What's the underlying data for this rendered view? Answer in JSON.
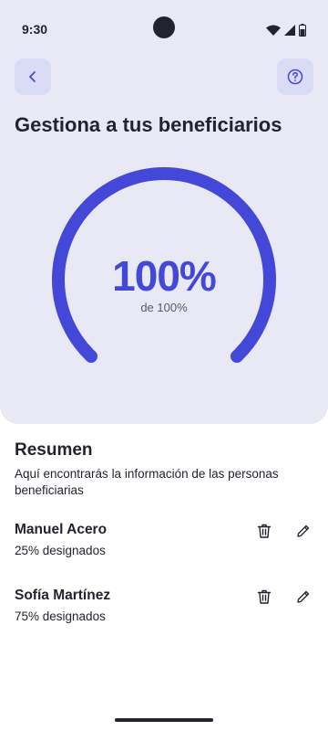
{
  "status_bar": {
    "time": "9:30"
  },
  "header": {
    "title": "Gestiona a tus beneficiarios",
    "back_icon": "chevron-left-icon",
    "help_icon": "help-circle-icon"
  },
  "gauge": {
    "value_label": "100%",
    "subtitle": "de 100%",
    "percent": 100,
    "color": "#4448d8"
  },
  "summary": {
    "title": "Resumen",
    "description": "Aquí encontrarás la información de las personas beneficiarias"
  },
  "beneficiaries": [
    {
      "name": "Manuel Acero",
      "share": "25% designados"
    },
    {
      "name": "Sofía Martínez",
      "share": "75% designados"
    }
  ],
  "colors": {
    "accent": "#4448d8",
    "header_bg": "#e8e9f4",
    "button_bg": "#dadcf6",
    "text": "#23232f"
  }
}
